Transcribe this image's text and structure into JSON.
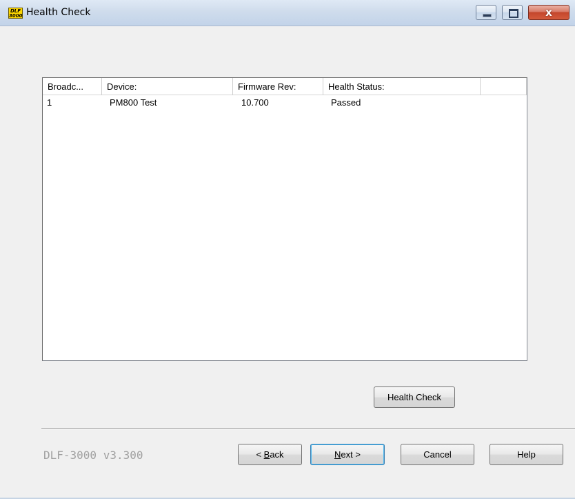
{
  "window": {
    "title": "Health Check",
    "app_icon_text": "DLF 3000",
    "controls": {
      "close_glyph": "x"
    }
  },
  "listview": {
    "columns": [
      "Broadc...",
      "Device:",
      "Firmware Rev:",
      "Health Status:",
      ""
    ],
    "rows": [
      {
        "broadcast": "1",
        "device": "PM800 Test",
        "firmware_rev": "10.700",
        "health_status": "Passed"
      }
    ]
  },
  "actions": {
    "health_check_label": "Health Check"
  },
  "footer": {
    "version": "DLF-3000 v3.300",
    "back_prefix": "< ",
    "back_mnemonic": "B",
    "back_rest": "ack",
    "next_mnemonic": "N",
    "next_rest": "ext >",
    "cancel_label": "Cancel",
    "help_label": "Help"
  }
}
